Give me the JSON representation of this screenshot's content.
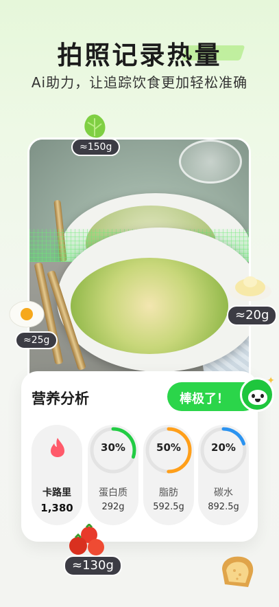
{
  "header": {
    "title": "拍照记录热量",
    "subtitle": "Ai助力，让追踪饮食更加轻松准确"
  },
  "photo": {
    "weights": {
      "lettuce": "≈150g",
      "egg": "≈25g",
      "sauce": "≈20g",
      "tomato": "≈130g"
    }
  },
  "nutrition": {
    "title": "营养分析",
    "praise": "棒极了！",
    "calories": {
      "label": "卡路里",
      "value": "1,380"
    },
    "macros": [
      {
        "pct_text": "30%",
        "pct": 0.3,
        "label": "蛋白质",
        "value": "292g",
        "color": "#22cc44"
      },
      {
        "pct_text": "50%",
        "pct": 0.5,
        "label": "脂肪",
        "value": "592.5g",
        "color": "#ff9f1a"
      },
      {
        "pct_text": "20%",
        "pct": 0.2,
        "label": "碳水",
        "value": "892.5g",
        "color": "#2b93f0"
      }
    ]
  },
  "colors": {
    "accent": "#2bd54a",
    "flame": "#ff5a6a"
  }
}
